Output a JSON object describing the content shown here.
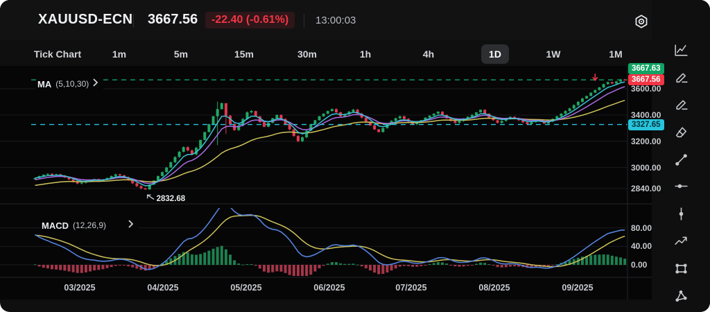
{
  "topbar": {
    "symbol": "XAUUSD-ECN",
    "price": "3667.56",
    "change": "-22.40 (-0.61%)",
    "time": "13:00:03"
  },
  "timeframes": {
    "items": [
      "Tick Chart",
      "1m",
      "5m",
      "15m",
      "30m",
      "1h",
      "4h",
      "1D",
      "1W",
      "1M"
    ],
    "selected": "1D"
  },
  "indicators": {
    "ma": {
      "label": "MA",
      "params": "(5,10,30)"
    },
    "macd": {
      "label": "MACD",
      "params": "(12,26,9)"
    }
  },
  "sidebar_tools": [
    "chart-type",
    "draw",
    "annotate",
    "eraser",
    "trend-line",
    "horizontal-line",
    "vertical-line",
    "zigzag",
    "rectangle",
    "polygon"
  ],
  "colors": {
    "up": "#22a863",
    "down": "#e03a50",
    "ma5": "#3ac2d4",
    "ma10": "#ad6ce4",
    "ma30": "#cfc45a",
    "macd_line": "#5583dc",
    "macd_signal": "#cfc45a",
    "hist_up": "#1d8050",
    "hist_down": "#a53649",
    "accent_red": "#f23645",
    "accent_green": "#11a464",
    "accent_cyan": "#27c5dd",
    "grid": "#1a1b1c",
    "separator": "#242527"
  },
  "chart_data": {
    "type": "candlestick",
    "symbol": "XAUUSD-ECN",
    "timeframe": "1D",
    "x_labels": [
      "03/2025",
      "04/2025",
      "05/2025",
      "06/2025",
      "07/2025",
      "08/2025",
      "09/2025"
    ],
    "y_ticks": [
      3600,
      3400,
      3200,
      3000,
      2840
    ],
    "macd_ticks": [
      80,
      40,
      0
    ],
    "price_lines": [
      {
        "price": 3667.63,
        "color": "green",
        "badge": "3667.63"
      },
      {
        "price": 3327.65,
        "color": "cyan",
        "badge": "3327.65"
      }
    ],
    "last_price": {
      "value": 3667.56,
      "badge": "3667.56",
      "color": "red"
    },
    "annotation": {
      "text": "2832.68",
      "index": 26
    },
    "markers": [
      {
        "type": "sell-arrow",
        "index": 132
      }
    ],
    "ma_periods": [
      5,
      10,
      30
    ],
    "macd_params": [
      12,
      26,
      9
    ],
    "closes": [
      2920,
      2935,
      2945,
      2952,
      2940,
      2948,
      2938,
      2925,
      2910,
      2892,
      2878,
      2885,
      2895,
      2905,
      2912,
      2900,
      2908,
      2920,
      2935,
      2948,
      2940,
      2925,
      2905,
      2880,
      2858,
      2842,
      2833,
      2870,
      2900,
      2935,
      2965,
      3000,
      3040,
      3080,
      3120,
      3155,
      3130,
      3100,
      3150,
      3210,
      3270,
      3330,
      3390,
      3445,
      3490,
      3395,
      3330,
      3285,
      3320,
      3370,
      3420,
      3430,
      3390,
      3345,
      3310,
      3340,
      3375,
      3400,
      3370,
      3330,
      3290,
      3240,
      3200,
      3230,
      3280,
      3330,
      3360,
      3390,
      3410,
      3430,
      3445,
      3420,
      3390,
      3405,
      3425,
      3440,
      3410,
      3380,
      3350,
      3320,
      3290,
      3270,
      3300,
      3330,
      3355,
      3375,
      3390,
      3370,
      3350,
      3330,
      3345,
      3360,
      3380,
      3395,
      3410,
      3425,
      3400,
      3375,
      3355,
      3340,
      3355,
      3370,
      3385,
      3400,
      3420,
      3440,
      3410,
      3380,
      3360,
      3340,
      3355,
      3370,
      3385,
      3375,
      3360,
      3345,
      3330,
      3345,
      3365,
      3350,
      3335,
      3350,
      3370,
      3390,
      3410,
      3430,
      3450,
      3475,
      3500,
      3525,
      3545,
      3570,
      3590,
      3610,
      3635,
      3650,
      3640,
      3655,
      3670,
      3667.56
    ],
    "wick_overrides": {
      "43": [
        3502,
        3170
      ],
      "45": [
        3460,
        3255
      ]
    }
  }
}
